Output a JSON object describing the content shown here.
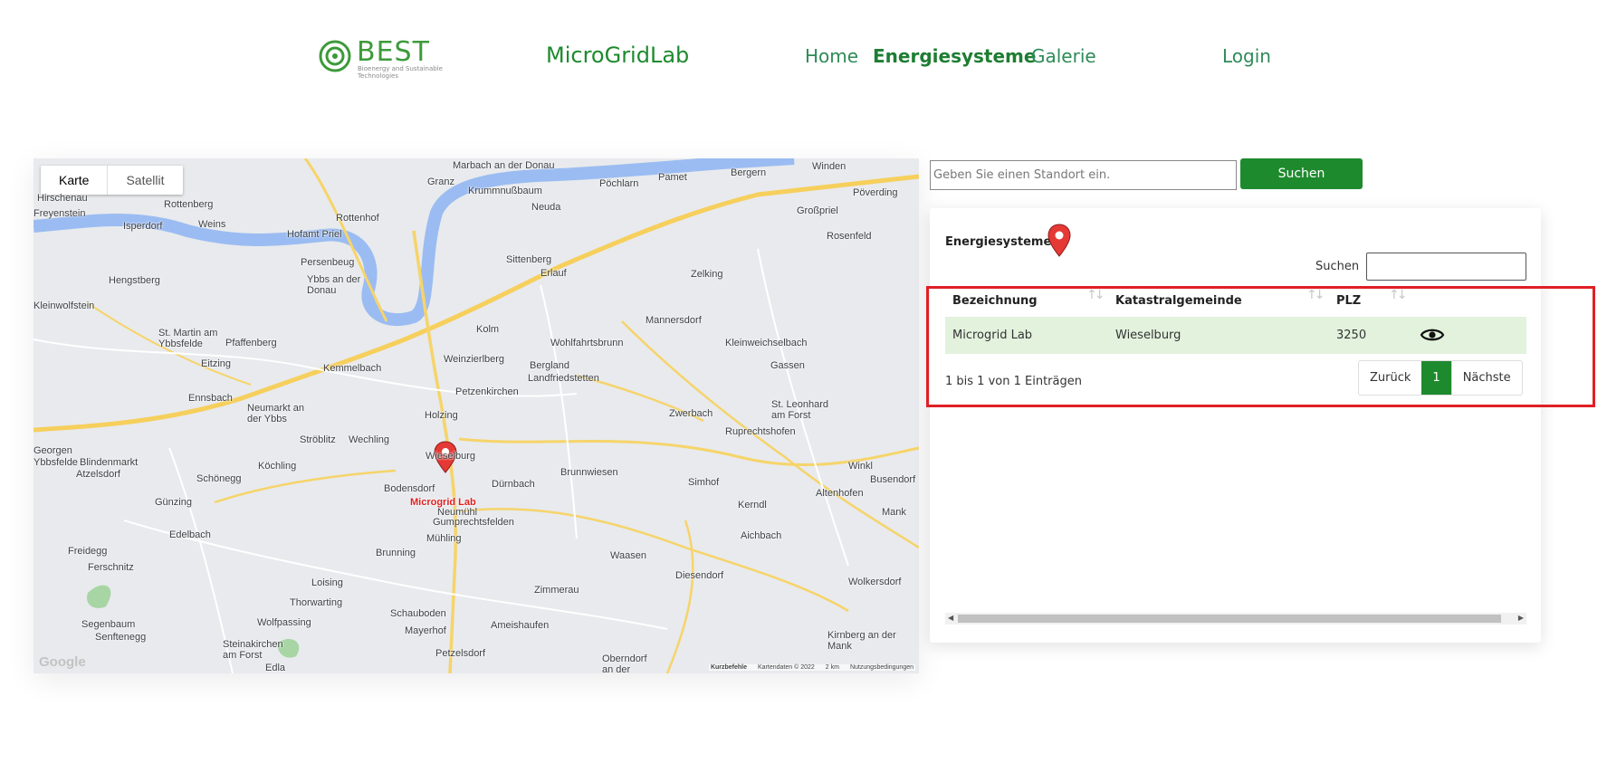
{
  "header": {
    "logo": {
      "text": "BEST",
      "subtitle": "Bioenergy and Sustainable Technologies"
    },
    "brand": "MicroGridLab",
    "nav": [
      {
        "label": "Home"
      },
      {
        "label": "Energiesysteme"
      },
      {
        "label": "Galerie"
      }
    ],
    "login": "Login"
  },
  "map": {
    "type_buttons": [
      "Karte",
      "Satellit"
    ],
    "marker_label": "Microgrid Lab",
    "google": "Google",
    "footer": {
      "shortcuts": "Kurzbefehle",
      "mapdata": "Kartendaten © 2022",
      "scale": "2 km",
      "terms": "Nutzungsbedingungen"
    },
    "places": [
      "Marbach an der Donau",
      "Winden",
      "Bergern",
      "Pamet",
      "Pöchlarn",
      "Granz",
      "Krummnußbaum",
      "Neuda",
      "Pöverding",
      "Großpriel",
      "Rottenberg",
      "Hirschenau",
      "Freyenstein",
      "Isperdorf",
      "Weins",
      "Rottenhof",
      "Hofamt Priel",
      "Rosenfeld",
      "Persenbeug",
      "Sittenberg",
      "Erlauf",
      "Zelking",
      "Hengstberg",
      "Ybbs an der Donau",
      "Kleinwolfstein",
      "Kolm",
      "Mannersdorf",
      "St. Martin am Ybbsfelde",
      "Pfaffenberg",
      "Wohlfahrtsbrunn",
      "Kleinweichselbach",
      "Eitzing",
      "Kemmelbach",
      "Weinzierlberg",
      "Bergland",
      "Landfriedstetten",
      "Gassen",
      "Ennsbach",
      "Petzenkirchen",
      "St. Leonhard am Forst",
      "Neumarkt an der Ybbs",
      "Holzing",
      "Zwerbach",
      "Ruprechtshofen",
      "Georgen",
      "Ybbsfelde",
      "Blindenmarkt",
      "Ströblitz",
      "Wechling",
      "Wieselburg",
      "Winkl",
      "Atzelsdorf",
      "Köchling",
      "Schönegg",
      "Bodensdorf",
      "Dürnbach",
      "Brunnwiesen",
      "Simhof",
      "Busendorf",
      "Altenhofen",
      "Günzing",
      "Neumühl",
      "Kerndl",
      "Mank",
      "Edelbach",
      "Gumprechtsfelden",
      "Mühling",
      "Aichbach",
      "Freidegg",
      "Brunning",
      "Waasen",
      "Ferschnitz",
      "Diesendorf",
      "Wolkersdorf",
      "Loising",
      "Zimmerau",
      "Thorwarting",
      "Schauboden",
      "Ameishaufen",
      "Segenbaum",
      "Senftenegg",
      "Wolfpassing",
      "Mayerhof",
      "Kirnberg an der Mank",
      "Steinakirchen am Forst",
      "Edla",
      "Petzelsdorf",
      "Oberndorf an der"
    ]
  },
  "search": {
    "placeholder": "Geben Sie einen Standort ein.",
    "button": "Suchen"
  },
  "panel": {
    "title": "Energiesysteme",
    "filter_label": "Suchen",
    "columns": [
      "Bezeichnung",
      "Katastralgemeinde",
      "PLZ"
    ],
    "rows": [
      {
        "bezeichnung": "Microgrid Lab",
        "katastralgemeinde": "Wieselburg",
        "plz": "3250"
      }
    ],
    "info": "1 bis 1 von 1 Einträgen",
    "pager": {
      "prev": "Zurück",
      "current": "1",
      "next": "Nächste"
    }
  },
  "colors": {
    "accent": "#1e8a2e",
    "highlight": "#e01f26",
    "row": "#e2f2dd"
  }
}
